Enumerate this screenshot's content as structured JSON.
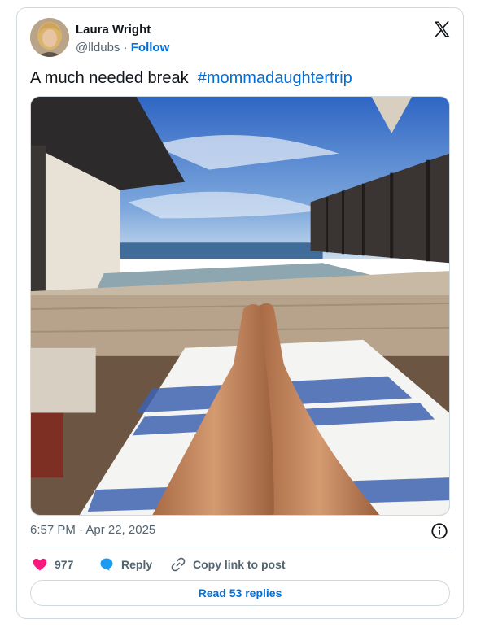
{
  "author": {
    "name": "Laura Wright",
    "handle": "@lldubs",
    "separator": "·",
    "follow_label": "Follow"
  },
  "tweet": {
    "text": "A much needed break",
    "hashtag": "#mommadaughtertrip"
  },
  "media": {
    "description_icon": "photo"
  },
  "meta": {
    "timestamp": "6:57 PM · Apr 22, 2025"
  },
  "actions": {
    "like_count": "977",
    "reply_label": "Reply",
    "copy_link_label": "Copy link to post"
  },
  "read_replies_label": "Read 53 replies",
  "colors": {
    "accent": "#006fd6",
    "like": "#f91880",
    "reply": "#1d9bf0",
    "muted": "#536471",
    "border": "#cfd9de"
  }
}
